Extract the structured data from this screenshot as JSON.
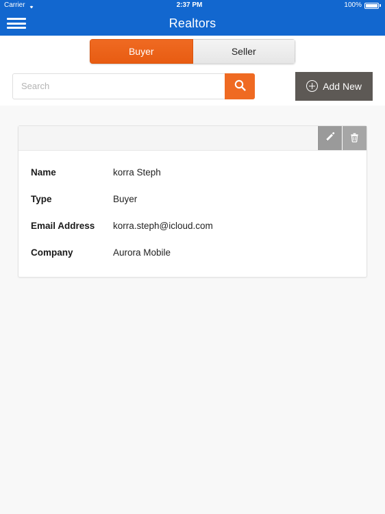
{
  "status_bar": {
    "carrier": "Carrier",
    "wifi_icon": "wifi-icon",
    "time": "2:37 PM",
    "battery_percent": "100%",
    "battery_icon": "battery-full-icon"
  },
  "nav": {
    "menu_icon": "hamburger-menu-icon",
    "title": "Realtors"
  },
  "segmented_control": {
    "options": [
      {
        "label": "Buyer",
        "selected": true
      },
      {
        "label": "Seller",
        "selected": false
      }
    ],
    "active_color": "#ef6a22",
    "inactive_color": "#ebebeb"
  },
  "toolbar": {
    "search_placeholder": "Search",
    "search_value": "",
    "search_icon": "magnifier-icon",
    "add_new_label": "Add New",
    "add_new_icon": "plus-circle-icon",
    "add_new_color": "#5d5955"
  },
  "card": {
    "edit_icon": "pencil-icon",
    "delete_icon": "trash-icon",
    "rows": [
      {
        "label": "Name",
        "value": "korra Steph"
      },
      {
        "label": "Type",
        "value": "Buyer"
      },
      {
        "label": "Email Address",
        "value": "korra.steph@icloud.com"
      },
      {
        "label": "Company",
        "value": "Aurora Mobile"
      }
    ]
  },
  "theme": {
    "navbar_color": "#1267cf",
    "page_background": "#f8f8f8"
  }
}
